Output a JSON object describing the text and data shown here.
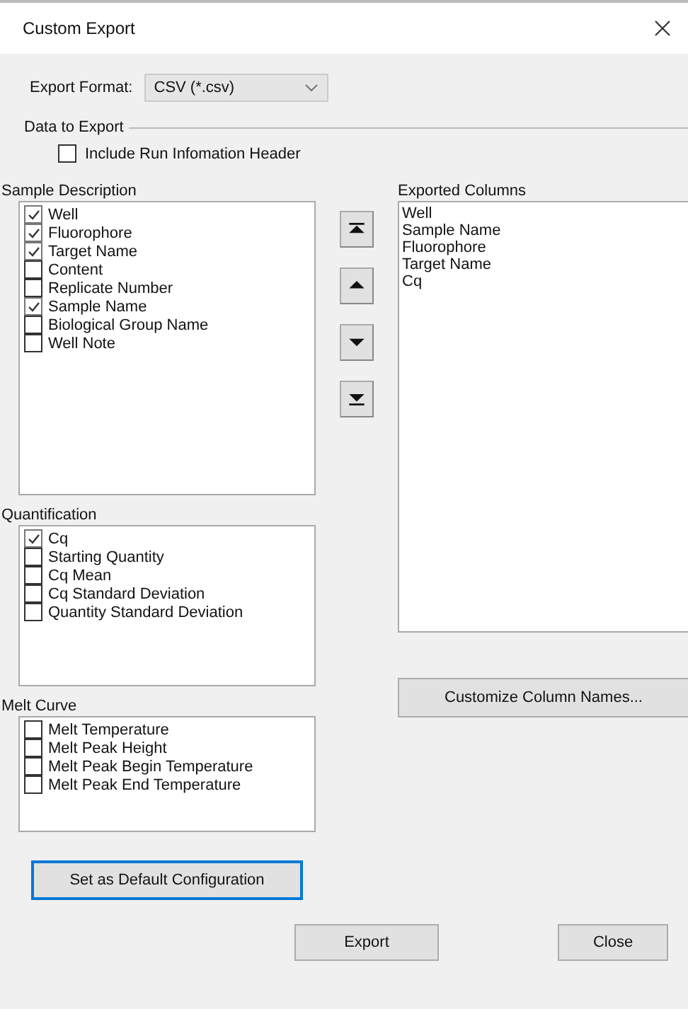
{
  "window": {
    "title": "Custom Export"
  },
  "export_format": {
    "label": "Export Format:",
    "value": "CSV (*.csv)"
  },
  "data_to_export": {
    "label": "Data to Export",
    "include_header": {
      "label": "Include Run Infomation Header",
      "checked": false
    }
  },
  "sample_description": {
    "label": "Sample Description",
    "items": [
      {
        "label": "Well",
        "checked": true
      },
      {
        "label": "Fluorophore",
        "checked": true
      },
      {
        "label": "Target Name",
        "checked": true
      },
      {
        "label": "Content",
        "checked": false
      },
      {
        "label": "Replicate Number",
        "checked": false
      },
      {
        "label": "Sample Name",
        "checked": true
      },
      {
        "label": "Biological Group Name",
        "checked": false
      },
      {
        "label": "Well Note",
        "checked": false
      }
    ]
  },
  "move_buttons": [
    {
      "kind": "top"
    },
    {
      "kind": "up"
    },
    {
      "kind": "down"
    },
    {
      "kind": "bottom"
    }
  ],
  "exported_columns": {
    "label": "Exported Columns",
    "items": [
      "Well",
      "Sample Name",
      "Fluorophore",
      "Target Name",
      "Cq"
    ]
  },
  "quantification": {
    "label": "Quantification",
    "items": [
      {
        "label": "Cq",
        "checked": true
      },
      {
        "label": "Starting Quantity",
        "checked": false
      },
      {
        "label": "Cq Mean",
        "checked": false
      },
      {
        "label": "Cq Standard Deviation",
        "checked": false
      },
      {
        "label": "Quantity Standard Deviation",
        "checked": false
      }
    ]
  },
  "customize_button": "Customize Column Names...",
  "melt_curve": {
    "label": "Melt Curve",
    "items": [
      {
        "label": "Melt Temperature",
        "checked": false
      },
      {
        "label": "Melt Peak Height",
        "checked": false
      },
      {
        "label": "Melt Peak Begin Temperature",
        "checked": false
      },
      {
        "label": "Melt Peak End Temperature",
        "checked": false
      }
    ]
  },
  "default_button": {
    "label": "Set as Default Configuration",
    "focused": true
  },
  "buttons": [
    "Export",
    "Close"
  ]
}
